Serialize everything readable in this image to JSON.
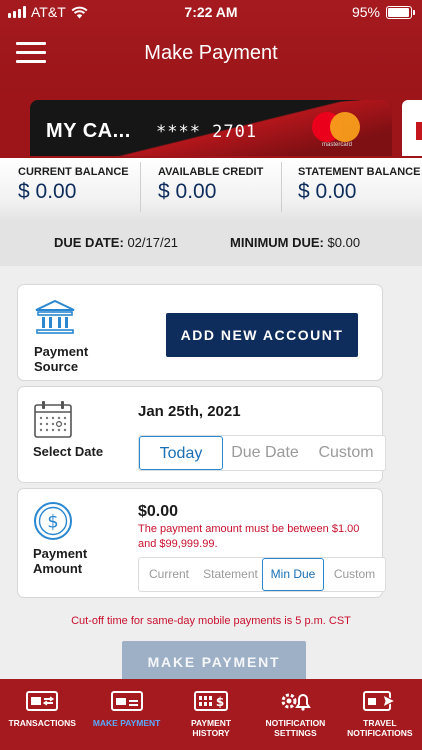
{
  "status_bar": {
    "carrier": "AT&T",
    "time": "7:22 AM",
    "battery": "95%",
    "battery_level": 0.95
  },
  "header": {
    "title": "Make Payment"
  },
  "card": {
    "name": "MY CA...",
    "number_masked": "**** 2701",
    "brand": "mastercard"
  },
  "balances": [
    {
      "label": "CURRENT BALANCE",
      "value": "$ 0.00"
    },
    {
      "label": "AVAILABLE CREDIT",
      "value": "$ 0.00"
    },
    {
      "label": "STATEMENT BALANCE",
      "value": "$ 0.00"
    }
  ],
  "due": {
    "due_label": "DUE DATE:",
    "due_value": "02/17/21",
    "min_label": "MINIMUM DUE:",
    "min_value": "$0.00"
  },
  "payment_source": {
    "label_line1": "Payment",
    "label_line2": "Source",
    "button": "ADD NEW ACCOUNT"
  },
  "select_date": {
    "label": "Select Date",
    "value": "Jan 25th, 2021",
    "options": [
      "Today",
      "Due Date",
      "Custom"
    ],
    "selected": "Today"
  },
  "payment_amount": {
    "label_line1": "Payment",
    "label_line2": "Amount",
    "value": "$0.00",
    "error": "The payment amount must be between $1.00 and $99,999.99.",
    "options": [
      "Current",
      "Statement",
      "Min Due",
      "Custom"
    ],
    "selected": "Min Due"
  },
  "cutoff_note": "Cut-off time for same-day mobile payments is 5 p.m. CST",
  "make_payment_button": "MAKE PAYMENT",
  "bottom_nav": [
    {
      "line1": "TRANSACTIONS",
      "line2": "",
      "icon": "transactions-icon",
      "active": false
    },
    {
      "line1": "MAKE PAYMENT",
      "line2": "",
      "icon": "card-payment-icon",
      "active": true
    },
    {
      "line1": "PAYMENT",
      "line2": "HISTORY",
      "icon": "payment-history-icon",
      "active": false
    },
    {
      "line1": "NOTIFICATION",
      "line2": "SETTINGS",
      "icon": "notification-settings-icon",
      "active": false
    },
    {
      "line1": "TRAVEL",
      "line2": "NOTIFICATIONS",
      "icon": "travel-icon",
      "active": false
    }
  ],
  "colors": {
    "brand_red": "#a51a1f",
    "navy": "#0f2d5c",
    "link_blue": "#2a87d0",
    "error_red": "#c8102e",
    "disabled_button": "#9db0c6"
  }
}
